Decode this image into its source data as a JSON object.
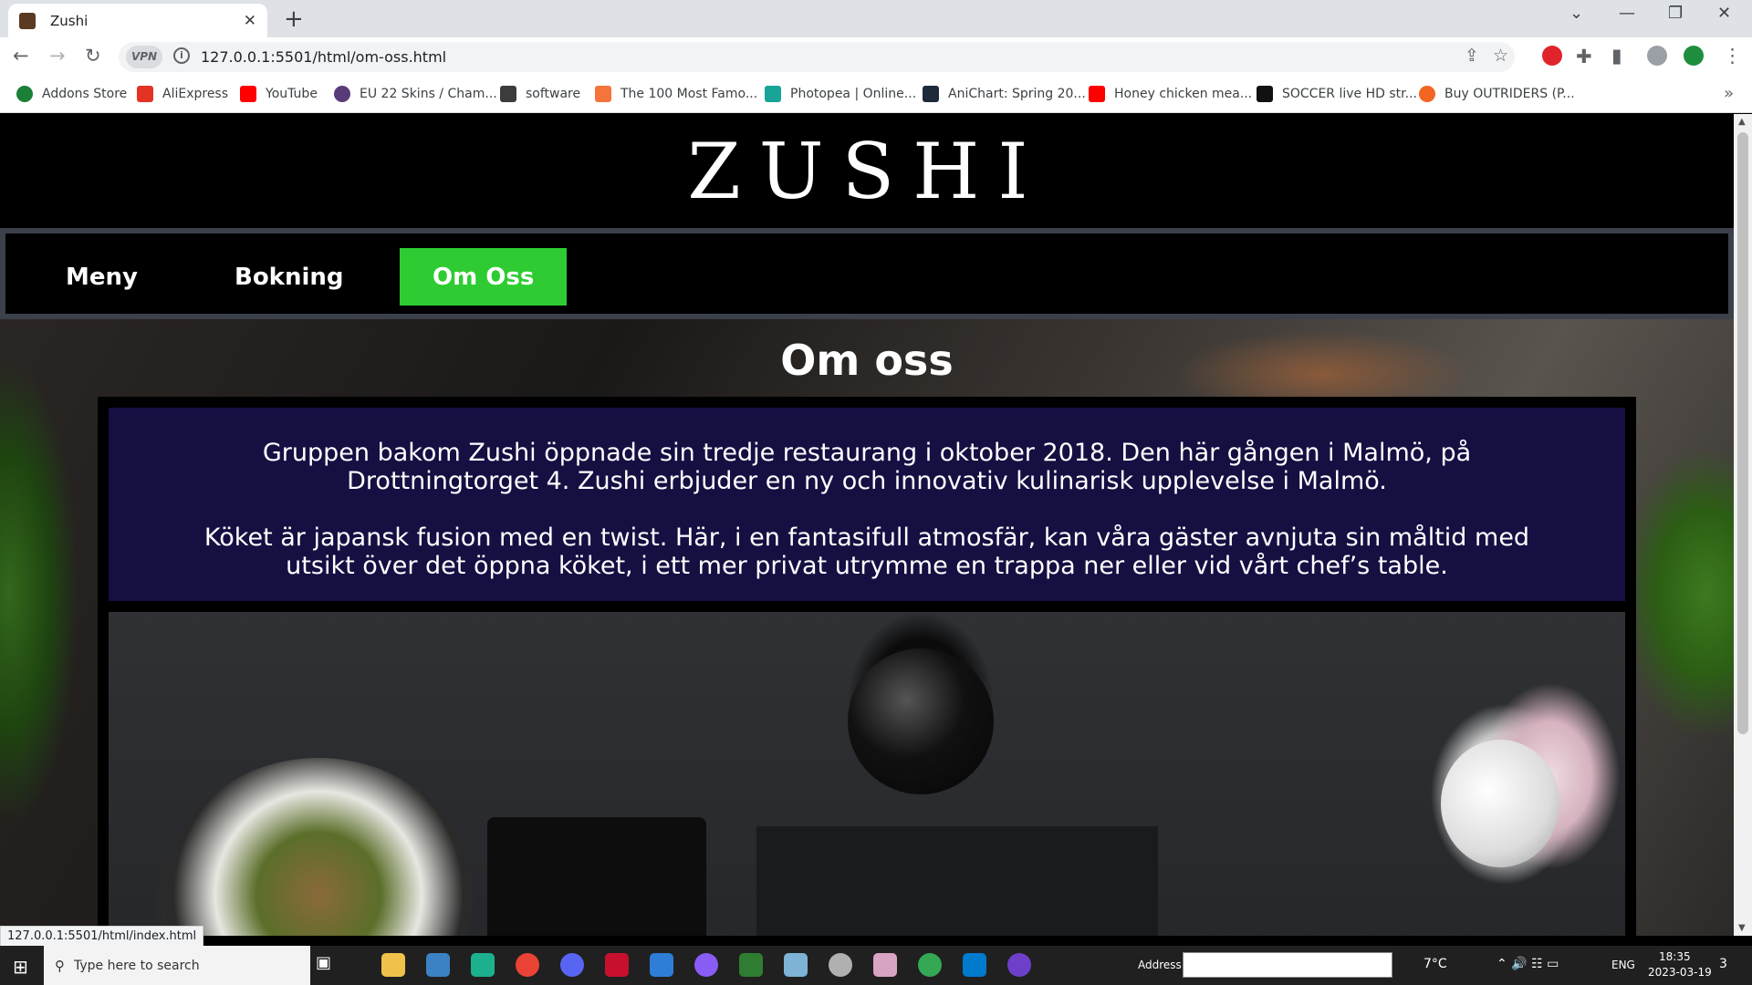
{
  "browser": {
    "tab_title": "Zushi",
    "tab_close": "✕",
    "new_tab": "+",
    "url": "127.0.0.1:5501/html/om-oss.html",
    "vpn_label": "VPN",
    "status_url": "127.0.0.1:5501/html/index.html",
    "bookmarks": [
      {
        "label": "Addons Store",
        "color": "#1a7f37"
      },
      {
        "label": "AliExpress",
        "color": "#e43225"
      },
      {
        "label": "YouTube",
        "color": "#ff0000"
      },
      {
        "label": "EU 22 Skins / Cham...",
        "color": "#5a3b7a"
      },
      {
        "label": "software",
        "color": "#3c3c3c"
      },
      {
        "label": "The 100 Most Famo...",
        "color": "#f4743b"
      },
      {
        "label": "Photopea | Online...",
        "color": "#18a497"
      },
      {
        "label": "AniChart: Spring 20...",
        "color": "#1e2a3a"
      },
      {
        "label": "Honey chicken mea...",
        "color": "#ff0000"
      },
      {
        "label": "SOCCER live HD str...",
        "color": "#111111"
      },
      {
        "label": "Buy OUTRIDERS (P...",
        "color": "#f26522"
      }
    ]
  },
  "site": {
    "logo": "ZUSHI",
    "nav": [
      {
        "label": "Meny",
        "active": false
      },
      {
        "label": "Bokning",
        "active": false
      },
      {
        "label": "Om Oss",
        "active": true
      }
    ],
    "page_title": "Om oss",
    "paragraphs": [
      "Gruppen bakom Zushi öppnade sin tredje restaurang i oktober 2018. Den här gången i Malmö, på Drottningtorget 4. Zushi erbjuder en ny och innovativ kulinarisk upplevelse i Malmö.",
      "Köket är japansk fusion med en twist. Här, i en fantasifull atmosfär, kan våra gäster avnjuta sin måltid med utsikt över det öppna köket, i ett mer privat utrymme en trappa ner eller vid vårt chef’s table."
    ],
    "colors": {
      "nav_active": "#2ecc32",
      "textbox_bg": "#150f42",
      "nav_border": "#3b404a"
    }
  },
  "taskbar": {
    "search_placeholder": "Type here to search",
    "address_label": "Address",
    "weather": "7°C",
    "language": "ENG",
    "time": "18:35",
    "date": "2023-03-19",
    "notification_count": "3"
  }
}
